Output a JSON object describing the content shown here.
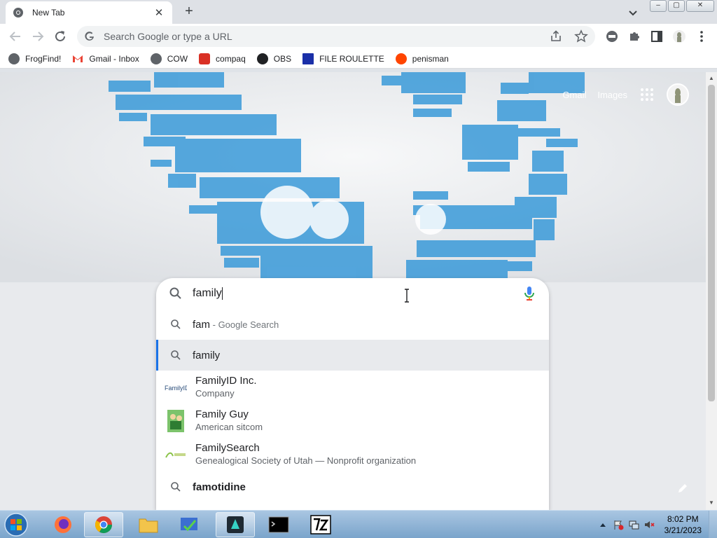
{
  "tab": {
    "title": "New Tab",
    "close": "✕"
  },
  "new_tab": "+",
  "window_controls": {
    "minimize": "–",
    "maximize": "▢",
    "close": "✕"
  },
  "omnibox": {
    "placeholder": "Search Google or type a URL"
  },
  "bookmarks": [
    {
      "label": "FrogFind!",
      "icon": "globe-icon",
      "color": "#5f6368"
    },
    {
      "label": "Gmail - Inbox",
      "icon": "gmail-icon",
      "color": "#ea4335"
    },
    {
      "label": "COW",
      "icon": "globe-icon",
      "color": "#5f6368"
    },
    {
      "label": "compaq",
      "icon": "compaq-icon",
      "color": "#d93025"
    },
    {
      "label": "OBS",
      "icon": "github-icon",
      "color": "#202124"
    },
    {
      "label": "FILE ROULETTE",
      "icon": "mft-icon",
      "color": "#1a2fa8"
    },
    {
      "label": "penisman",
      "icon": "reddit-icon",
      "color": "#ff4500"
    }
  ],
  "top_links": {
    "gmail": "Gmail",
    "images": "Images"
  },
  "search": {
    "query": "family",
    "suggestions": [
      {
        "kind": "simple",
        "bold": "fam",
        "rest": " - Google Search",
        "rest_style": "secondary",
        "selected": false
      },
      {
        "kind": "simple",
        "bold": "family",
        "rest": "",
        "selected": true
      },
      {
        "kind": "rich",
        "title": "FamilyID Inc.",
        "subtitle": "Company",
        "thumb": "familyid-logo"
      },
      {
        "kind": "rich",
        "title": "Family Guy",
        "subtitle": "American sitcom",
        "thumb": "familyguy-thumb"
      },
      {
        "kind": "rich",
        "title": "FamilySearch",
        "subtitle": "Genealogical Society of Utah — Nonprofit organization",
        "thumb": "familysearch-logo"
      },
      {
        "kind": "simple",
        "bold": "famotidine",
        "rest": "",
        "selected": false
      }
    ]
  },
  "taskbar": {
    "apps": [
      "firefox",
      "chrome",
      "explorer",
      "control-panel",
      "filmora",
      "cmd",
      "7zip"
    ],
    "active_app": "chrome",
    "clock": {
      "time": "8:02 PM",
      "date": "3/21/2023"
    }
  },
  "colors": {
    "accent": "#1a73e8",
    "wordcloud_blue": "#3a9ad9"
  }
}
